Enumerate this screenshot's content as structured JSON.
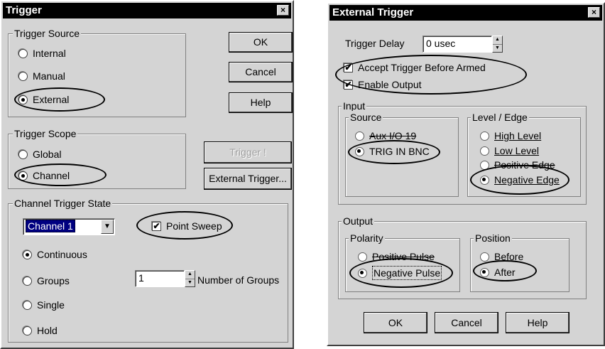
{
  "trigger": {
    "title": "Trigger",
    "close": "×",
    "source": {
      "legend": "Trigger Source",
      "options": [
        "Internal",
        "Manual",
        "External"
      ],
      "selected": "External"
    },
    "buttons": {
      "ok": "OK",
      "cancel": "Cancel",
      "help": "Help",
      "trigger_now": "Trigger !",
      "external_trigger": "External Trigger..."
    },
    "scope": {
      "legend": "Trigger Scope",
      "options": [
        "Global",
        "Channel"
      ],
      "selected": "Channel"
    },
    "channel_state": {
      "legend": "Channel Trigger State",
      "channel_value": "Channel 1",
      "point_sweep_label": "Point Sweep",
      "point_sweep_checked": true,
      "options": [
        "Continuous",
        "Groups",
        "Single",
        "Hold"
      ],
      "selected": "Continuous",
      "groups_value": "1",
      "groups_label": "Number of Groups"
    }
  },
  "external": {
    "title": "External Trigger",
    "close": "×",
    "delay_label": "Trigger Delay",
    "delay_value": "0 usec",
    "accept_label": "Accept Trigger Before Armed",
    "accept_checked": true,
    "enable_label": "Enable Output",
    "enable_checked": true,
    "input": {
      "legend": "Input",
      "source": {
        "legend": "Source",
        "options": [
          "Aux I/O 19",
          "TRIG IN BNC"
        ],
        "selected": "TRIG IN BNC"
      },
      "level": {
        "legend": "Level / Edge",
        "options": [
          "High Level",
          "Low Level",
          "Positive Edge",
          "Negative Edge"
        ],
        "selected": "Negative Edge"
      }
    },
    "output": {
      "legend": "Output",
      "polarity": {
        "legend": "Polarity",
        "options": [
          "Positive Pulse",
          "Negative Pulse"
        ],
        "selected": "Negative Pulse"
      },
      "position": {
        "legend": "Position",
        "options": [
          "Before",
          "After"
        ],
        "selected": "After"
      }
    },
    "buttons": {
      "ok": "OK",
      "cancel": "Cancel",
      "help": "Help"
    }
  },
  "check_mark": "✔"
}
